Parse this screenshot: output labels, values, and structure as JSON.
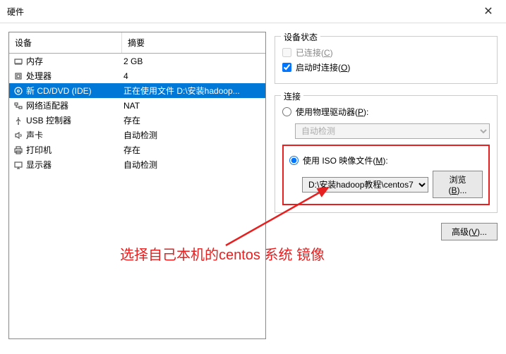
{
  "title": "硬件",
  "columns": {
    "device": "设备",
    "summary": "摘要"
  },
  "devices": [
    {
      "name": "内存",
      "summary": "2 GB",
      "icon": "memory-icon"
    },
    {
      "name": "处理器",
      "summary": "4",
      "icon": "cpu-icon"
    },
    {
      "name": "新 CD/DVD (IDE)",
      "summary": "正在使用文件 D:\\安装hadoop...",
      "icon": "disc-icon",
      "selected": true
    },
    {
      "name": "网络适配器",
      "summary": "NAT",
      "icon": "network-icon"
    },
    {
      "name": "USB 控制器",
      "summary": "存在",
      "icon": "usb-icon"
    },
    {
      "name": "声卡",
      "summary": "自动检测",
      "icon": "sound-icon"
    },
    {
      "name": "打印机",
      "summary": "存在",
      "icon": "printer-icon"
    },
    {
      "name": "显示器",
      "summary": "自动检测",
      "icon": "display-icon"
    }
  ],
  "device_status": {
    "group_label": "设备状态",
    "connected": {
      "label": "已连接(",
      "shortcut": "C",
      "suffix": ")",
      "checked": false,
      "enabled": false
    },
    "connect_on_start": {
      "label": "启动时连接(",
      "shortcut": "O",
      "suffix": ")",
      "checked": true
    }
  },
  "connection": {
    "group_label": "连接",
    "physical": {
      "label": "使用物理驱动器(",
      "shortcut": "P",
      "suffix": "):",
      "selected": false
    },
    "physical_dropdown": "自动检测",
    "iso": {
      "label": "使用 ISO 映像文件(",
      "shortcut": "M",
      "suffix": "):",
      "selected": true
    },
    "iso_path": "D:\\安装hadoop教程\\centos7",
    "browse": {
      "label": "浏览(",
      "shortcut": "B",
      "suffix": ")..."
    }
  },
  "advanced": {
    "label": "高级(",
    "shortcut": "V",
    "suffix": ")..."
  },
  "annotation_text": "选择自己本机的centos 系统 镜像"
}
